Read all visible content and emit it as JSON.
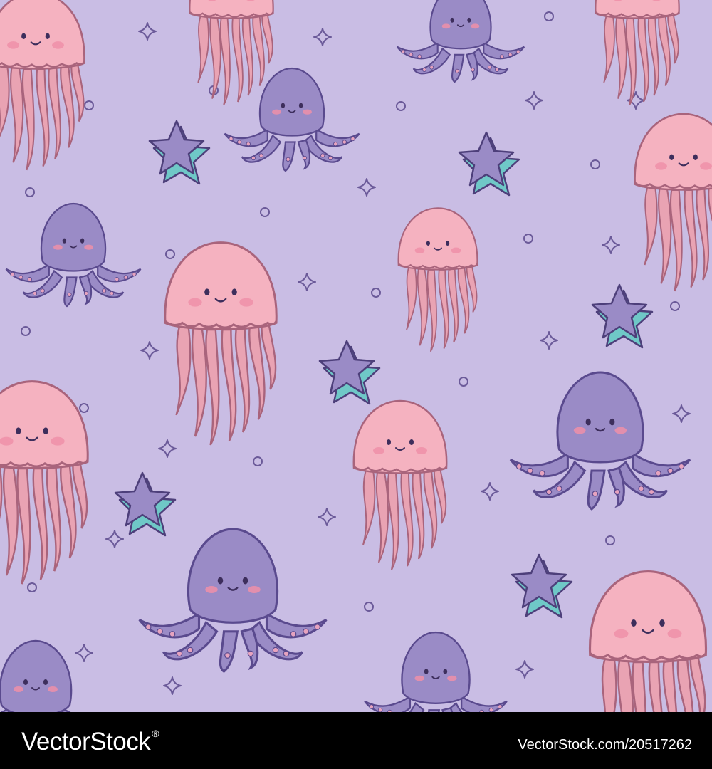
{
  "colors": {
    "background": "#c9bde4",
    "octopus_body": "#9a8bc6",
    "octopus_outline": "#5a4a8e",
    "octopus_dots": "#e6a3bf",
    "jellyfish_bell": "#f5b2c0",
    "jellyfish_bell_shade": "#ee9fb1",
    "jellyfish_tentacle": "#e9a3b3",
    "jellyfish_outline": "#a9647c",
    "cheek": "#ee8fa8",
    "star_face": "#9a8bc6",
    "star_side": "#6fc8c7",
    "sparkle": "#6b5a99",
    "footer": "#000000",
    "footer_text": "#ffffff"
  },
  "scene": {
    "description_icons": [
      "octopus-icon",
      "jellyfish-icon",
      "starfish-icon",
      "sparkle-icon",
      "bubble-icon"
    ]
  },
  "footer": {
    "brand": "VectorStock",
    "trademark": "®",
    "credit": "VectorStock.com/20517262"
  }
}
